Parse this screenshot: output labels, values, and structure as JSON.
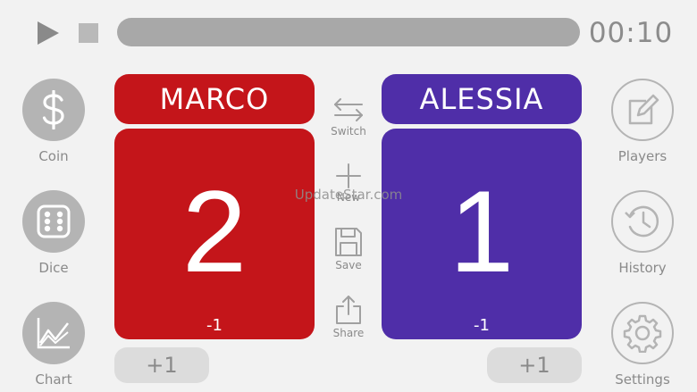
{
  "timer": {
    "value": "00:10",
    "progress": 0.0
  },
  "sidebar_left": [
    {
      "label": "Coin",
      "icon": "dollar-icon"
    },
    {
      "label": "Dice",
      "icon": "dice-icon"
    },
    {
      "label": "Chart",
      "icon": "chart-icon"
    }
  ],
  "sidebar_right": [
    {
      "label": "Players",
      "icon": "edit-icon"
    },
    {
      "label": "History",
      "icon": "history-icon"
    },
    {
      "label": "Settings",
      "icon": "gear-icon"
    }
  ],
  "players": [
    {
      "name": "MARCO",
      "score": "2",
      "delta": "-1",
      "plus": "+1",
      "color": "#c4151a"
    },
    {
      "name": "ALESSIA",
      "score": "1",
      "delta": "-1",
      "plus": "+1",
      "color": "#4f2ea8"
    }
  ],
  "tools": [
    {
      "label": "Switch",
      "icon": "switch-icon"
    },
    {
      "label": "New",
      "icon": "plus-icon"
    },
    {
      "label": "Save",
      "icon": "save-icon"
    },
    {
      "label": "Share",
      "icon": "share-icon"
    }
  ],
  "watermark": "UpdateStar.com"
}
